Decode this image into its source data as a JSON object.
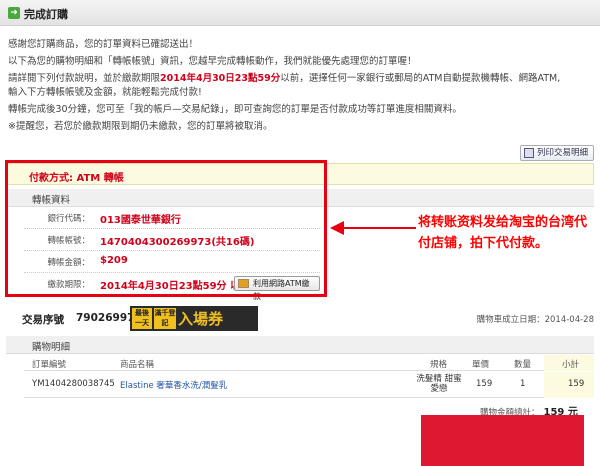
{
  "header": {
    "icon": "arrow-right-icon",
    "icon_glyph": "➜",
    "title": "完成訂購"
  },
  "intro": {
    "line1": "感謝您訂購商品，您的訂單資料已確認送出！",
    "line2": "以下為您的購物明細和「轉帳帳號」資訊，您越早完成轉帳動作，我們就能優先處理您的訂單喔！",
    "line3_a": "請詳閱下列付款說明，並於繳款期限",
    "line3_deadline": "2014年4月30日23點59分",
    "line3_b": "以前，選擇任何一家銀行或郵局的ATM自動提款機轉帳、網路ATM,",
    "line4": "輸入下方轉帳帳號及金額，就能輕鬆完成付款!",
    "line5": "轉帳完成後30分鐘，您可至「我的帳戶—交易紀錄」，即可查詢您的訂單是否付款成功等訂單進度相關資料。",
    "line6": "※提醒您，若您於繳款期限到期仍未繳款，您的訂單將被取消。"
  },
  "print_button": {
    "label": "列印交易明細"
  },
  "payment_method": {
    "label": "付款方式: ATM 轉帳"
  },
  "transfer": {
    "section_title": "轉帳資料",
    "rows": [
      {
        "label": "銀行代碼：",
        "value": "013國泰世華銀行"
      },
      {
        "label": "轉帳帳號：",
        "value": "1470404300269973(共16碼)"
      },
      {
        "label": "轉帳金額：",
        "value": "$209"
      },
      {
        "label": "繳款期限：",
        "value": "2014年4月30日23點59分 以前"
      }
    ],
    "atm_button": "利用網路ATM繳款"
  },
  "annotation": "将转账资料发给淘宝的台湾代付店铺，拍下代付款。",
  "transaction": {
    "label": "交易序號",
    "number": "79026997",
    "promo_a": "最後一天",
    "promo_b": "滿千登記",
    "promo_c": "入場券",
    "created": "購物車成立日期：2014-04-28"
  },
  "detail": {
    "title": "購物明細",
    "columns": [
      "訂單編號",
      "商品名稱",
      "規格",
      "單價",
      "數量",
      "小計"
    ],
    "rows": [
      {
        "order_no": "YM1404280038745",
        "product": "Elastine 奢華香水洗/潤髮乳",
        "spec": "洗髮精 甜蜜愛戀",
        "price": "159",
        "qty": "1",
        "subtotal": "159"
      }
    ],
    "total_label": "購物金額總計：",
    "total_value": "159 元"
  },
  "colors": {
    "accent_red": "#d0021b",
    "box_red": "#e60012",
    "link_blue": "#2255aa"
  }
}
